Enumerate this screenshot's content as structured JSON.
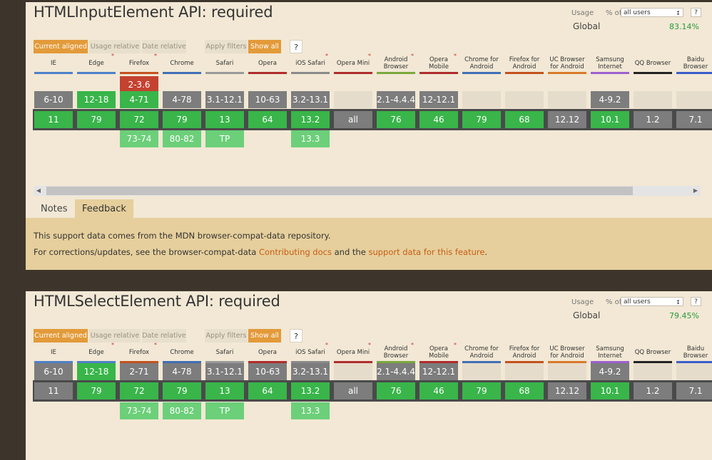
{
  "columns": [
    {
      "label": "IE",
      "star": false,
      "bar": "#4e80c9"
    },
    {
      "label": "Edge",
      "star": true,
      "bar": "#4e80c9"
    },
    {
      "label": "Firefox",
      "star": true,
      "bar": "#c4511e"
    },
    {
      "label": "Chrome",
      "star": false,
      "bar": "#3f6fb5"
    },
    {
      "label": "Safari",
      "star": false,
      "bar": "#9a9a9a"
    },
    {
      "label": "Opera",
      "star": false,
      "bar": "#b02c2c"
    },
    {
      "label": "iOS Safari",
      "star": true,
      "bar": "#8a8a8a"
    },
    {
      "label": "Opera Mini",
      "star": true,
      "bar": "#b02c2c"
    },
    {
      "label": "Android Browser",
      "star": true,
      "bar": "#7aa83c"
    },
    {
      "label": "Opera Mobile",
      "star": true,
      "bar": "#b02c2c"
    },
    {
      "label": "Chrome for Android",
      "star": false,
      "bar": "#3f6fb5"
    },
    {
      "label": "Firefox for Android",
      "star": false,
      "bar": "#c4511e"
    },
    {
      "label": "UC Browser for Android",
      "star": false,
      "bar": "#d87a2a"
    },
    {
      "label": "Samsung Internet",
      "star": false,
      "bar": "#9d5fd0"
    },
    {
      "label": "QQ Browser",
      "star": false,
      "bar": "#222222"
    },
    {
      "label": "Baidu Browser",
      "star": false,
      "bar": "#3a5dcc"
    }
  ],
  "labels": {
    "usage": "Usage",
    "pct_of": "% of",
    "users": "all users",
    "help": "?",
    "global": "Global",
    "current_aligned": "Current aligned",
    "usage_relative": "Usage relative",
    "date_relative": "Date relative",
    "apply_filters": "Apply filters",
    "show_all": "Show all",
    "hash": "#",
    "notes": "Notes",
    "feedback": "Feedback",
    "note_line1": "This support data comes from the MDN browser-compat-data repository.",
    "note_line2_pre": "For corrections/updates, see the browser-compat-data ",
    "link_contributing": "Contributing docs",
    "note_line2_mid": " and the ",
    "link_support": "support data for this feature",
    "note_line2_post": "."
  },
  "features": [
    {
      "title": "HTMLInputElement API: required",
      "global_pct": "83.14%",
      "rows": {
        "r0": [
          null,
          null,
          {
            "t": "2-3.6",
            "c": "red"
          },
          null,
          null,
          null,
          null,
          null,
          null,
          null,
          null,
          null,
          null,
          null,
          null,
          null
        ],
        "r1": [
          {
            "t": "6-10",
            "c": "grey"
          },
          {
            "t": "12-18",
            "c": "green"
          },
          {
            "t": "4-71",
            "c": "green"
          },
          {
            "t": "4-78",
            "c": "grey"
          },
          {
            "t": "3.1-12.1",
            "c": "grey"
          },
          {
            "t": "10-63",
            "c": "grey"
          },
          {
            "t": "3.2-13.1",
            "c": "grey"
          },
          {
            "t": "",
            "c": "empty"
          },
          {
            "t": "2.1-4.4.4",
            "c": "grey"
          },
          {
            "t": "12-12.1",
            "c": "grey"
          },
          {
            "t": "",
            "c": "empty"
          },
          {
            "t": "",
            "c": "empty"
          },
          {
            "t": "",
            "c": "empty"
          },
          {
            "t": "4-9.2",
            "c": "grey"
          },
          {
            "t": "",
            "c": "empty"
          },
          {
            "t": "",
            "c": "empty"
          }
        ],
        "cur": [
          {
            "t": "11",
            "c": "green"
          },
          {
            "t": "79",
            "c": "green"
          },
          {
            "t": "72",
            "c": "green"
          },
          {
            "t": "79",
            "c": "green"
          },
          {
            "t": "13",
            "c": "green"
          },
          {
            "t": "64",
            "c": "green"
          },
          {
            "t": "13.2",
            "c": "green"
          },
          {
            "t": "all",
            "c": "grey"
          },
          {
            "t": "76",
            "c": "green"
          },
          {
            "t": "46",
            "c": "green"
          },
          {
            "t": "79",
            "c": "green"
          },
          {
            "t": "68",
            "c": "green"
          },
          {
            "t": "12.12",
            "c": "grey"
          },
          {
            "t": "10.1",
            "c": "green"
          },
          {
            "t": "1.2",
            "c": "grey"
          },
          {
            "t": "7.1",
            "c": "grey"
          }
        ],
        "fut": [
          null,
          null,
          {
            "t": "73-74",
            "c": "lgreen"
          },
          {
            "t": "80-82",
            "c": "lgreen"
          },
          {
            "t": "TP",
            "c": "lgreen"
          },
          null,
          {
            "t": "13.3",
            "c": "lgreen"
          },
          null,
          null,
          null,
          null,
          null,
          null,
          null,
          null,
          null
        ]
      },
      "show_panel": true
    },
    {
      "title": "HTMLSelectElement API: required",
      "global_pct": "79.45%",
      "rows": {
        "r1": [
          {
            "t": "6-10",
            "c": "grey"
          },
          {
            "t": "12-18",
            "c": "green"
          },
          {
            "t": "2-71",
            "c": "grey"
          },
          {
            "t": "4-78",
            "c": "grey"
          },
          {
            "t": "3.1-12.1",
            "c": "grey"
          },
          {
            "t": "10-63",
            "c": "grey"
          },
          {
            "t": "3.2-13.1",
            "c": "grey"
          },
          {
            "t": "",
            "c": "empty"
          },
          {
            "t": "2.1-4.4.4",
            "c": "grey"
          },
          {
            "t": "12-12.1",
            "c": "grey"
          },
          {
            "t": "",
            "c": "empty"
          },
          {
            "t": "",
            "c": "empty"
          },
          {
            "t": "",
            "c": "empty"
          },
          {
            "t": "4-9.2",
            "c": "grey"
          },
          {
            "t": "",
            "c": "empty"
          },
          {
            "t": "",
            "c": "empty"
          }
        ],
        "cur": [
          {
            "t": "11",
            "c": "grey"
          },
          {
            "t": "79",
            "c": "green"
          },
          {
            "t": "72",
            "c": "green"
          },
          {
            "t": "79",
            "c": "green"
          },
          {
            "t": "13",
            "c": "green"
          },
          {
            "t": "64",
            "c": "green"
          },
          {
            "t": "13.2",
            "c": "green"
          },
          {
            "t": "all",
            "c": "grey"
          },
          {
            "t": "76",
            "c": "green"
          },
          {
            "t": "46",
            "c": "green"
          },
          {
            "t": "79",
            "c": "green"
          },
          {
            "t": "68",
            "c": "green"
          },
          {
            "t": "12.12",
            "c": "grey"
          },
          {
            "t": "10.1",
            "c": "green"
          },
          {
            "t": "1.2",
            "c": "grey"
          },
          {
            "t": "7.1",
            "c": "grey"
          }
        ],
        "fut": [
          null,
          null,
          {
            "t": "73-74",
            "c": "lgreen"
          },
          {
            "t": "80-82",
            "c": "lgreen"
          },
          {
            "t": "TP",
            "c": "lgreen"
          },
          null,
          {
            "t": "13.3",
            "c": "lgreen"
          },
          null,
          null,
          null,
          null,
          null,
          null,
          null,
          null,
          null
        ]
      },
      "show_panel": false
    }
  ]
}
